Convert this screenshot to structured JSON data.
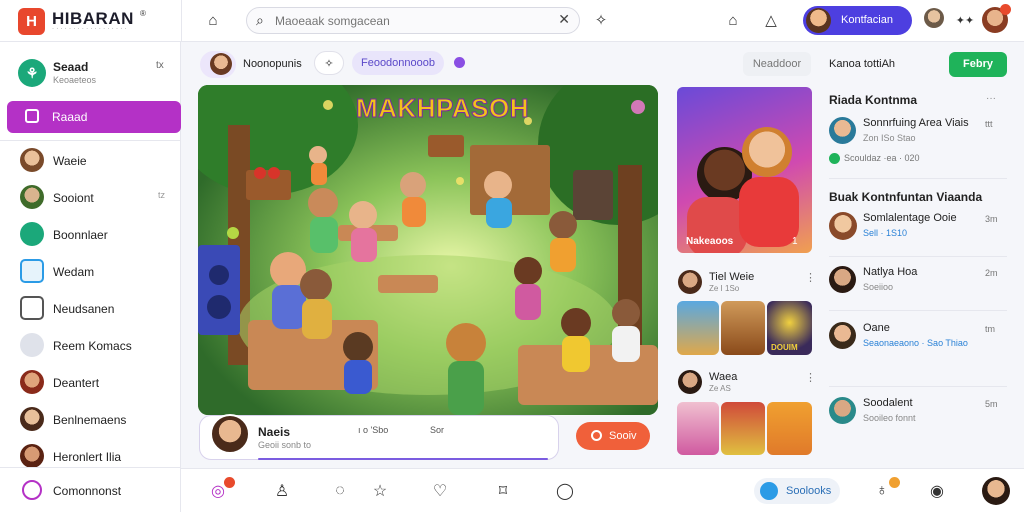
{
  "brand": {
    "logo_letter": "H",
    "name": "HIBARAN",
    "tagline": "· · · · · · · · · · · · · · · · · ·",
    "mark": "®"
  },
  "search": {
    "placeholder": "Maoeaak somgacean"
  },
  "profile": {
    "name": "Kontfacian"
  },
  "sidebar": {
    "header": {
      "title": "Seaad",
      "subtitle": "Keoaeteos",
      "close": "tx"
    },
    "active": "Raaad",
    "items": [
      {
        "label": "Waeie",
        "extra": ""
      },
      {
        "label": "Sooiont",
        "extra": "tz"
      },
      {
        "label": "Boonnlaer",
        "extra": ""
      },
      {
        "label": "Wedam",
        "extra": ""
      },
      {
        "label": "Neudsanen",
        "extra": ""
      },
      {
        "label": "Reem Komacs",
        "extra": ""
      },
      {
        "label": "Deantert",
        "extra": ""
      },
      {
        "label": "Benlnemaens",
        "extra": ""
      },
      {
        "label": "Heronlert Ilia",
        "extra": ""
      }
    ],
    "footer": "Comonnonst"
  },
  "main": {
    "header": {
      "name": "Noonopunis",
      "tag": "Feoodonnooob"
    },
    "scene_title": "MAKHPASOH",
    "post": {
      "name": "Naeis",
      "sub": "Geoii sonb to",
      "reaction_1": "ı o 'Sbo",
      "reaction_2": "Sor"
    },
    "save_label": "Sooiv"
  },
  "feed": {
    "hero_caption": "Nakeaoos",
    "hero_count": "1",
    "rows": [
      {
        "name": "Tiel Weie",
        "sub": "Ze I 1So"
      },
      {
        "name": "Waea",
        "sub": "Ze AS"
      }
    ],
    "thumb_label": "DOUIM"
  },
  "right": {
    "header_link": "Kanoa tottiAh",
    "follow_label": "Febry",
    "filter_label": "Neaddoor",
    "section_1": "Riada Kontnma",
    "section_2": "Buak Kontnfuntan Viaanda",
    "rows": [
      {
        "name": "Sonnrfuing Area Viais",
        "sub": "Zon ISo Stao",
        "time": "ttt"
      },
      {
        "name": "Scouldaz ·ea · 020",
        "sub": "",
        "time": ""
      },
      {
        "name": "Somlalentage Ooie",
        "sub": "Sell · 1S10",
        "time": "3m"
      },
      {
        "name": "Natlya Hoa",
        "sub": "Soeiioo",
        "time": "2m"
      },
      {
        "name": "Oane",
        "sub": "Seaonaeaono · Sao Thiao",
        "time": "tm"
      },
      {
        "name": "Soodalent",
        "sub": "Sooileo fonnt",
        "time": "5m"
      }
    ]
  },
  "bottom": {
    "schedule_label": "Soolooks"
  },
  "colors": {
    "accent": "#b431c6",
    "primary": "#4d3fe0",
    "save": "#f0603a",
    "follow": "#1fb35a",
    "brand": "#e8472d"
  },
  "icons": [
    "home-icon",
    "search-icon",
    "bell-icon",
    "chat-icon",
    "user-icon",
    "star-icon",
    "heart-icon",
    "bookmark-icon",
    "camera-icon"
  ]
}
